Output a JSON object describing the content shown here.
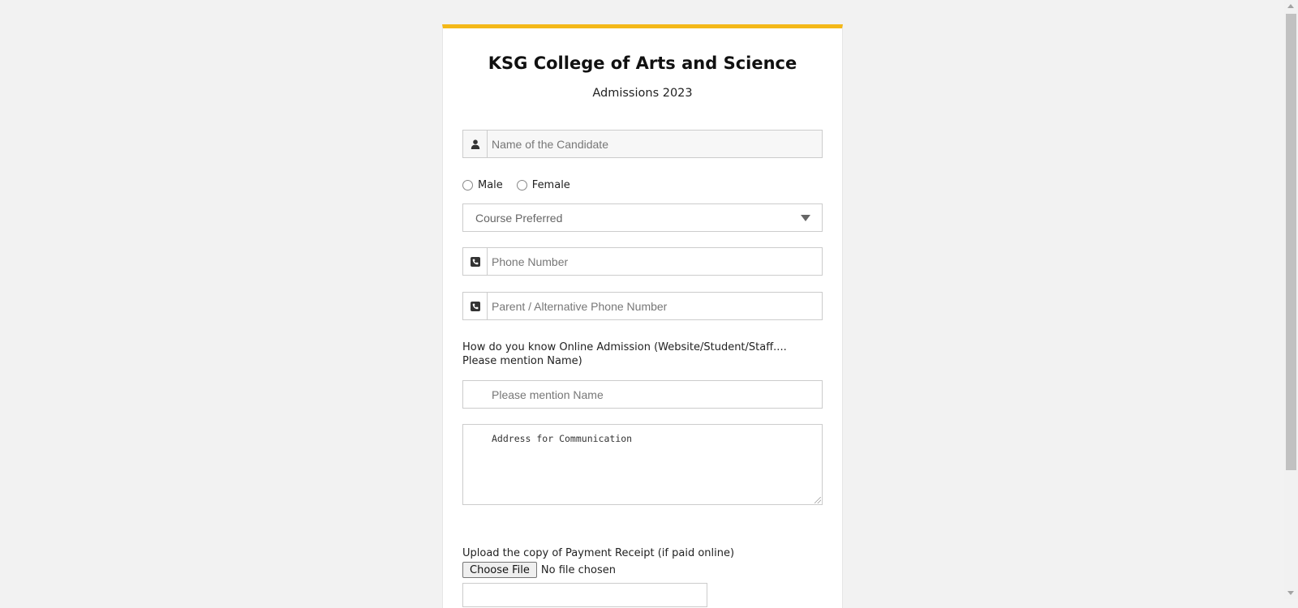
{
  "form": {
    "title": "KSG College of Arts and Science",
    "subtitle": "Admissions 2023",
    "name_placeholder": "Name of the Candidate",
    "gender_options": [
      "Male",
      "Female"
    ],
    "course_placeholder": "Course Preferred",
    "phone_placeholder": "Phone Number",
    "alt_phone_placeholder": "Parent / Alternative Phone Number",
    "referral_question": "How do you know Online Admission (Website/Student/Staff.... Please mention Name)",
    "referral_placeholder": "Please mention Name",
    "address_placeholder": "Address for Communication",
    "upload_label": "Upload the copy of Payment Receipt (if paid online)",
    "file_button_label": "Choose File",
    "file_status": "No file chosen"
  },
  "colors": {
    "accent": "#f4b818",
    "background": "#f2f2f2",
    "border": "#cccccc"
  },
  "icons": {
    "name": "user-icon",
    "phone": "phone-icon",
    "alt_phone": "phone-icon",
    "select": "chevron-down-icon"
  }
}
